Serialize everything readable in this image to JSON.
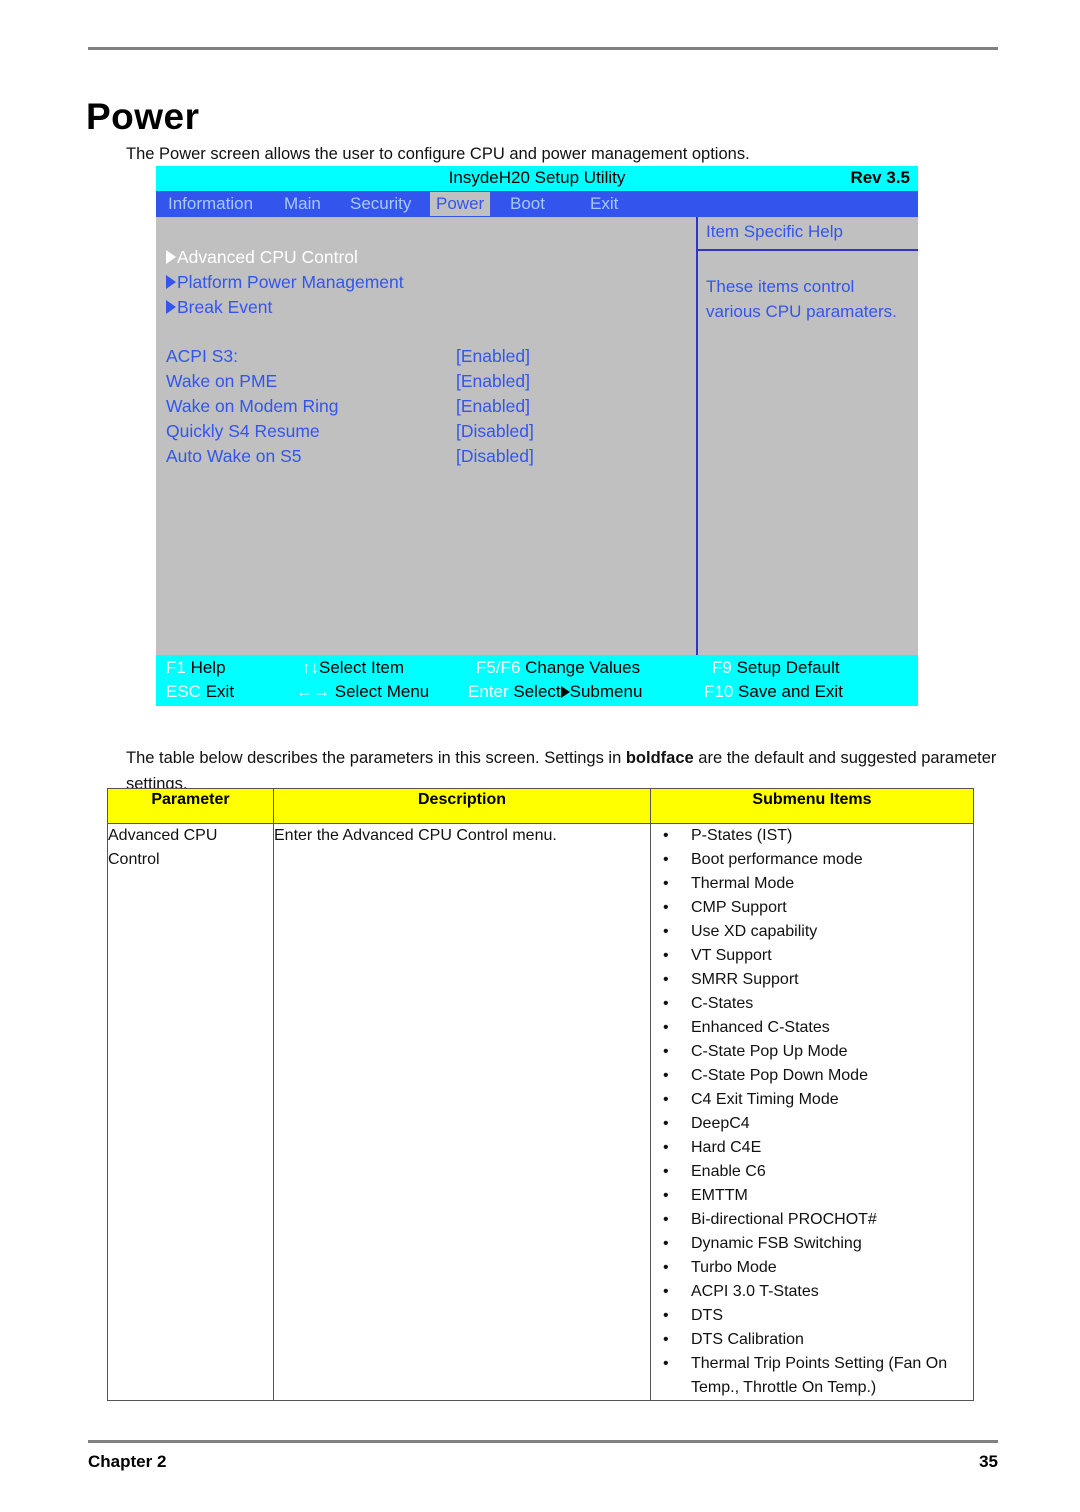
{
  "document": {
    "heading": "Power",
    "intro": "The Power screen allows the user to configure CPU and power management options.",
    "table_intro_before": "The table below describes the parameters in this screen. Settings in ",
    "table_intro_bold": "boldface",
    "table_intro_after": " are the default and suggested parameter settings.",
    "footer_left": "Chapter 2",
    "footer_right": "35"
  },
  "bios": {
    "title": "InsydeH20 Setup Utility",
    "revision": "Rev 3.5",
    "menu": [
      {
        "label": "Information",
        "active": false
      },
      {
        "label": "Main",
        "active": false
      },
      {
        "label": "Security",
        "active": false
      },
      {
        "label": "Power",
        "active": true
      },
      {
        "label": "Boot",
        "active": false
      },
      {
        "label": "Exit",
        "active": false
      }
    ],
    "submenus": [
      {
        "label": "Advanced CPU Control",
        "selected": true
      },
      {
        "label": "Platform Power Management",
        "selected": false
      },
      {
        "label": "Break Event",
        "selected": false
      }
    ],
    "options": [
      {
        "label": "ACPI S3:",
        "value": "[Enabled]"
      },
      {
        "label": "Wake on PME",
        "value": "[Enabled]"
      },
      {
        "label": "Wake on Modem Ring",
        "value": "[Enabled]"
      },
      {
        "label": "Quickly S4 Resume",
        "value": "[Disabled]"
      },
      {
        "label": "Auto Wake on S5",
        "value": "[Disabled]"
      }
    ],
    "help": {
      "title": "Item Specific Help",
      "line1": "These items control",
      "line2": "various CPU paramaters."
    },
    "footer_keys": [
      {
        "key": "F1",
        "action": "Help"
      },
      {
        "key": "↑↓",
        "action": "Select Item"
      },
      {
        "key": "F5/F6",
        "action": "Change Values"
      },
      {
        "key": "F9",
        "action": "Setup Default"
      },
      {
        "key": "ESC",
        "action": "Exit"
      },
      {
        "key": "←→",
        "action": "Select Menu"
      },
      {
        "key": "Enter",
        "action": "Select"
      },
      {
        "key": "",
        "action": "Submenu"
      },
      {
        "key": "F10",
        "action": "Save and Exit"
      }
    ],
    "colors": {
      "titlebar": "#00ffff",
      "menubar": "#3355ee",
      "body": "#c0c0c0",
      "text_blue": "#3355ee",
      "text_selected": "#ffffff",
      "footer": "#00ffff"
    }
  },
  "table": {
    "headers": [
      "Parameter",
      "Description",
      "Submenu Items"
    ],
    "header_bg": "#ffff00",
    "rows": [
      {
        "parameter": "Advanced CPU Control",
        "description": "Enter the Advanced CPU Control menu.",
        "submenu_items": [
          "P-States (IST)",
          "Boot performance mode",
          "Thermal Mode",
          "CMP Support",
          "Use XD capability",
          "VT Support",
          "SMRR Support",
          "C-States",
          "Enhanced C-States",
          "C-State Pop Up Mode",
          "C-State Pop Down Mode",
          "C4 Exit Timing Mode",
          "DeepC4",
          "Hard C4E",
          "Enable C6",
          "EMTTM",
          "Bi-directional PROCHOT#",
          "Dynamic FSB Switching",
          "Turbo Mode",
          "ACPI 3.0 T-States",
          "DTS",
          "DTS Calibration",
          "Thermal Trip Points Setting (Fan On Temp., Throttle On Temp.)"
        ]
      }
    ]
  }
}
